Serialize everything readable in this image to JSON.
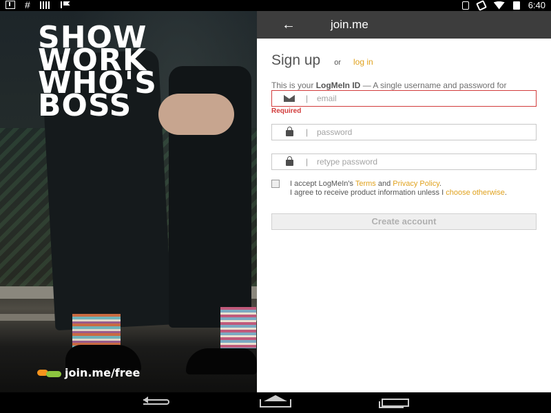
{
  "status_bar": {
    "time": "6:40",
    "left_icons": [
      "download-icon",
      "hash-icon",
      "signal-bars-icon",
      "flag-icon"
    ],
    "right_icons": [
      "bluetooth-icon",
      "vibrate-icon",
      "wifi-icon",
      "battery-icon"
    ]
  },
  "hero": {
    "tagline": [
      "SHOW",
      "WORK",
      "WHO'S",
      "BOSS"
    ],
    "link_text": "join.me/free",
    "logo_colors": [
      "#f7941d",
      "#8dc63f"
    ]
  },
  "app_bar": {
    "back_icon": "arrow-left-icon",
    "title": "join.me"
  },
  "signup": {
    "heading": "Sign up",
    "or_text": "or",
    "login_link": "log in",
    "description_prefix": "This is your ",
    "description_bold": "LogMeIn ID",
    "description_suffix": " — A single username and password for LogMeIn services.",
    "email": {
      "value": "",
      "placeholder": "email",
      "error": "Required"
    },
    "password": {
      "value": "",
      "placeholder": "password"
    },
    "retype_password": {
      "value": "",
      "placeholder": "retype password"
    },
    "terms": {
      "checked": false,
      "part1": "I accept LogMeIn's ",
      "terms_link": "Terms",
      "part2": " and ",
      "privacy_link": "Privacy Policy",
      "part3": ".",
      "part4": "I agree to receive product information unless I ",
      "choose_link": "choose otherwise",
      "part5": "."
    },
    "create_button": "Create account"
  },
  "colors": {
    "accent": "#e0a21e",
    "error": "#d23b3b",
    "appbar": "#3d3d3d"
  },
  "nav_bar": {
    "buttons": [
      "back-icon",
      "home-icon",
      "recents-icon"
    ]
  }
}
